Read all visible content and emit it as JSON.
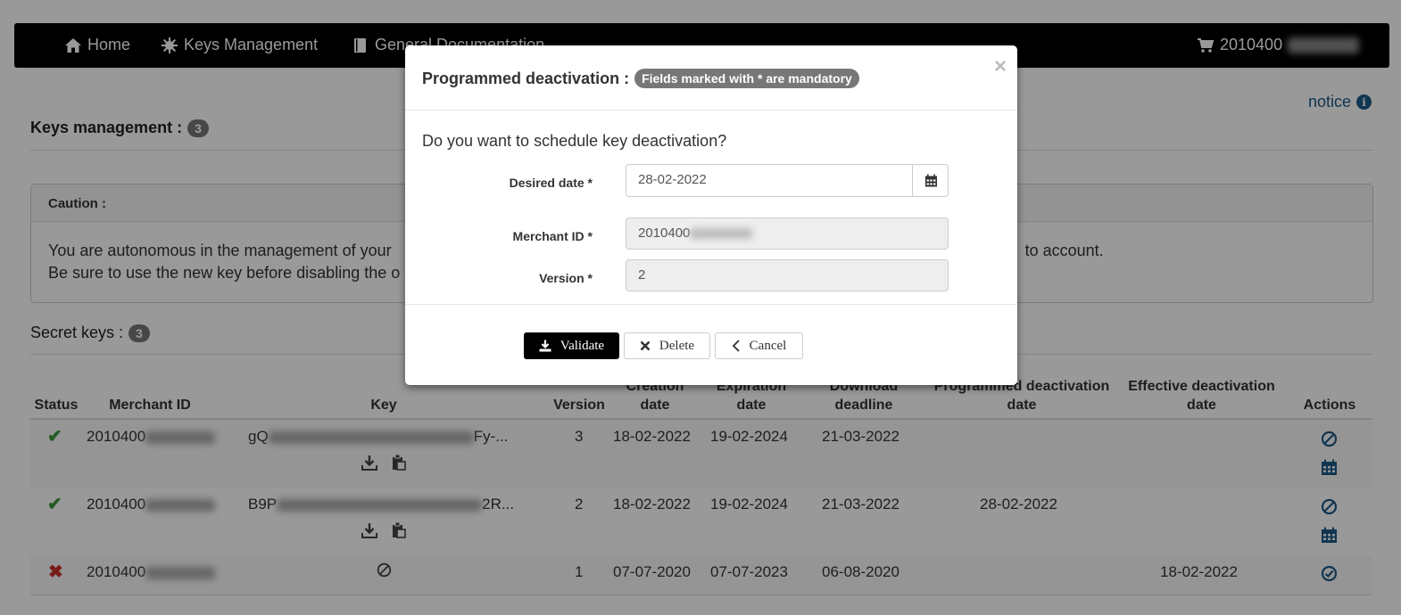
{
  "navbar": {
    "home": "Home",
    "keys_management": "Keys Management",
    "general_documentation": "General Documentation",
    "cart_prefix": "2010400"
  },
  "notice": {
    "label": "notice"
  },
  "keys_section": {
    "title": "Keys management :",
    "count": "3"
  },
  "caution": {
    "title": "Caution :",
    "line1_start": "You are autonomous in the management of your",
    "line1_end": "to account.",
    "line2_start": "Be sure to use the new key before disabling the o"
  },
  "secret_keys": {
    "title": "Secret keys :",
    "count": "3"
  },
  "table": {
    "headers": {
      "status": "Status",
      "merchant_id": "Merchant ID",
      "key": "Key",
      "version": "Version",
      "creation_1": "Creation",
      "creation_2": "date",
      "expiration_1": "Expiration",
      "expiration_2": "date",
      "download_1": "Download",
      "download_2": "deadline",
      "programmed_1": "Programmed deactivation",
      "programmed_2": "date",
      "effective_1": "Effective deactivation",
      "effective_2": "date",
      "actions": "Actions"
    },
    "rows": [
      {
        "merchant_prefix": "2010400",
        "key_start": "gQ",
        "key_end": "Fy-...",
        "version": "3",
        "creation": "18-02-2022",
        "expiration": "19-02-2024",
        "download": "21-03-2022",
        "programmed": "",
        "effective": ""
      },
      {
        "merchant_prefix": "2010400",
        "key_start": "B9P",
        "key_end": "2R...",
        "version": "2",
        "creation": "18-02-2022",
        "expiration": "19-02-2024",
        "download": "21-03-2022",
        "programmed": "28-02-2022",
        "effective": ""
      },
      {
        "merchant_prefix": "2010400",
        "key_start": "",
        "key_end": "",
        "version": "1",
        "creation": "07-07-2020",
        "expiration": "07-07-2023",
        "download": "06-08-2020",
        "programmed": "",
        "effective": "18-02-2022"
      }
    ]
  },
  "modal": {
    "title": "Programmed deactivation :",
    "badge": "Fields marked with * are mandatory",
    "question": "Do you want to schedule key deactivation?",
    "desired_date_label": "Desired date *",
    "desired_date_value": "28-02-2022",
    "merchant_id_label": "Merchant ID *",
    "merchant_id_prefix": "2010400",
    "version_label": "Version *",
    "version_value": "2",
    "validate_label": "Validate",
    "delete_label": "Delete",
    "cancel_label": "Cancel"
  },
  "colors": {
    "navbar_bg": "#000000",
    "link": "#1d5a87",
    "status_ok": "#3c9a3c",
    "status_ko": "#c9302c",
    "badge": "#777777"
  }
}
